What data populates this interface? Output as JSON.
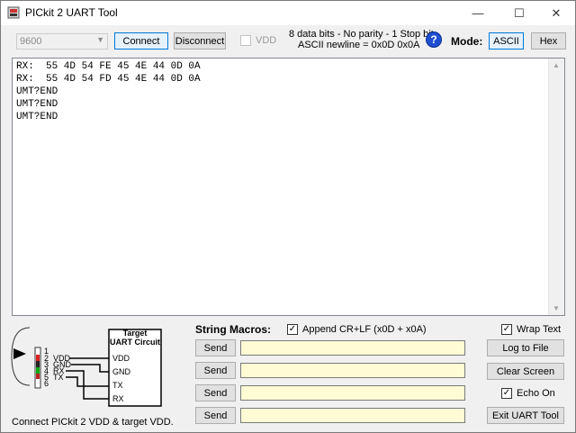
{
  "window": {
    "title": "PICkit 2 UART Tool",
    "minimize": "—",
    "maximize": "☐",
    "close": "✕"
  },
  "toolbar": {
    "baud": "9600",
    "connect": "Connect",
    "disconnect": "Disconnect",
    "vdd": "VDD",
    "info_line1": "8 data bits - No parity - 1 Stop bit.",
    "info_line2": "ASCII newline = 0x0D 0x0A",
    "help": "?",
    "mode_label": "Mode:",
    "ascii": "ASCII",
    "hex": "Hex"
  },
  "console": {
    "lines": [
      "RX:  55 4D 54 FE 45 4E 44 0D 0A",
      "RX:  55 4D 54 FD 45 4E 44 0D 0A",
      "UMT?END",
      "UMT?END",
      "UMT?END"
    ]
  },
  "diagram": {
    "title_line1": "Target",
    "title_line2": "UART Circuit",
    "pins": [
      "1",
      "2",
      "3",
      "4",
      "5",
      "6"
    ],
    "wire_labels": [
      "VDD",
      "GND",
      "RX",
      "TX"
    ],
    "target_labels": [
      "VDD",
      "GND",
      "TX",
      "RX"
    ],
    "footer": "Connect PICkit 2 VDD & target VDD."
  },
  "macros": {
    "title": "String Macros:",
    "append_label": "Append CR+LF (x0D + x0A)",
    "append_checked": "✓",
    "send": "Send",
    "values": [
      "",
      "",
      "",
      ""
    ]
  },
  "right": {
    "wrap_text": "Wrap Text",
    "wrap_checked": "✓",
    "log_to_file": "Log to File",
    "clear_screen": "Clear Screen",
    "echo_on": "Echo On",
    "echo_checked": "✓",
    "exit": "Exit UART Tool"
  }
}
